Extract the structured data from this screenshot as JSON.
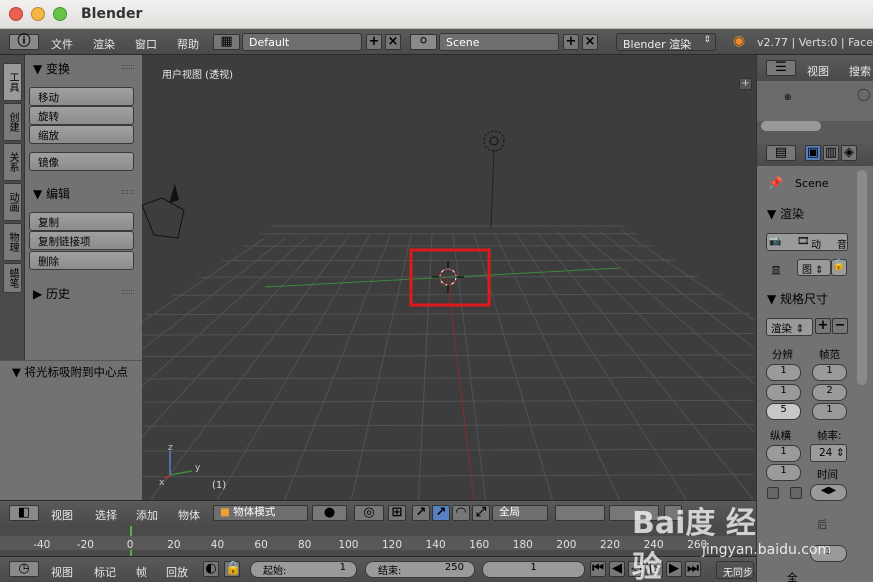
{
  "window": {
    "title": "Blender"
  },
  "top_menu": {
    "items": [
      "文件",
      "渲染",
      "窗口",
      "帮助"
    ],
    "layout_value": "Default",
    "scene_value": "Scene",
    "engine_value": "Blender 渲染",
    "stats": "v2.77 | Verts:0 | Faces"
  },
  "tool_tabs": [
    "工具",
    "创建",
    "关系",
    "动画",
    "物理",
    "蜡笔"
  ],
  "tool_panel": {
    "transform_header": "变换",
    "transform_buttons": [
      "移动",
      "旋转",
      "缩放"
    ],
    "mirror_button": "镜像",
    "edit_header": "编辑",
    "edit_buttons": [
      "复制",
      "复制链接项",
      "删除"
    ],
    "history_header": "历史",
    "snap_header": "将光标吸附到中心点"
  },
  "viewport": {
    "label": "用户视图 (透视)",
    "frame": "(1)",
    "axis_x": "x",
    "axis_y": "y",
    "axis_z": "z"
  },
  "outliner": {
    "view": "视图",
    "search": "搜索"
  },
  "properties": {
    "scene": "Scene",
    "render_header": "渲染",
    "render_btns": [
      "动",
      "音"
    ],
    "display_label": "显",
    "display_value": "图",
    "dimensions_header": "规格尺寸",
    "render_preset": "渲染",
    "resolution_label": "分辨",
    "framerange_label": "帧范",
    "res_values": [
      "1",
      "1",
      "5"
    ],
    "frame_values": [
      "1",
      "2",
      "1"
    ],
    "aspect_label": "纵横",
    "aspect_values": [
      "1",
      "1"
    ],
    "fps_label": "帧率:",
    "fps_value": "24",
    "time_label": "时间",
    "bottom_label": "后",
    "bottom_value": "1",
    "bottom_label2": "全"
  },
  "viewport_header": {
    "menus": [
      "视图",
      "选择",
      "添加",
      "物体"
    ],
    "mode": "物体模式",
    "pivot": "全局"
  },
  "timeline": {
    "ticks": [
      "-40",
      "-20",
      "0",
      "20",
      "40",
      "60",
      "80",
      "100",
      "120",
      "140",
      "160",
      "180",
      "200",
      "220",
      "240",
      "260"
    ],
    "menus": [
      "视图",
      "标记",
      "帧",
      "回放"
    ],
    "start_label": "起始:",
    "start_value": "1",
    "end_label": "结束:",
    "end_value": "250",
    "current_value": "1",
    "sync": "无同步"
  },
  "watermark": {
    "text": "Bai度 经验",
    "url": "jingyan.baidu.com"
  },
  "colors": {
    "accent": "#5680c2",
    "highlight_box": "#e0191c",
    "grid": "#555555",
    "x_axis": "#8b2b2b",
    "y_axis": "#3c8a3c"
  }
}
